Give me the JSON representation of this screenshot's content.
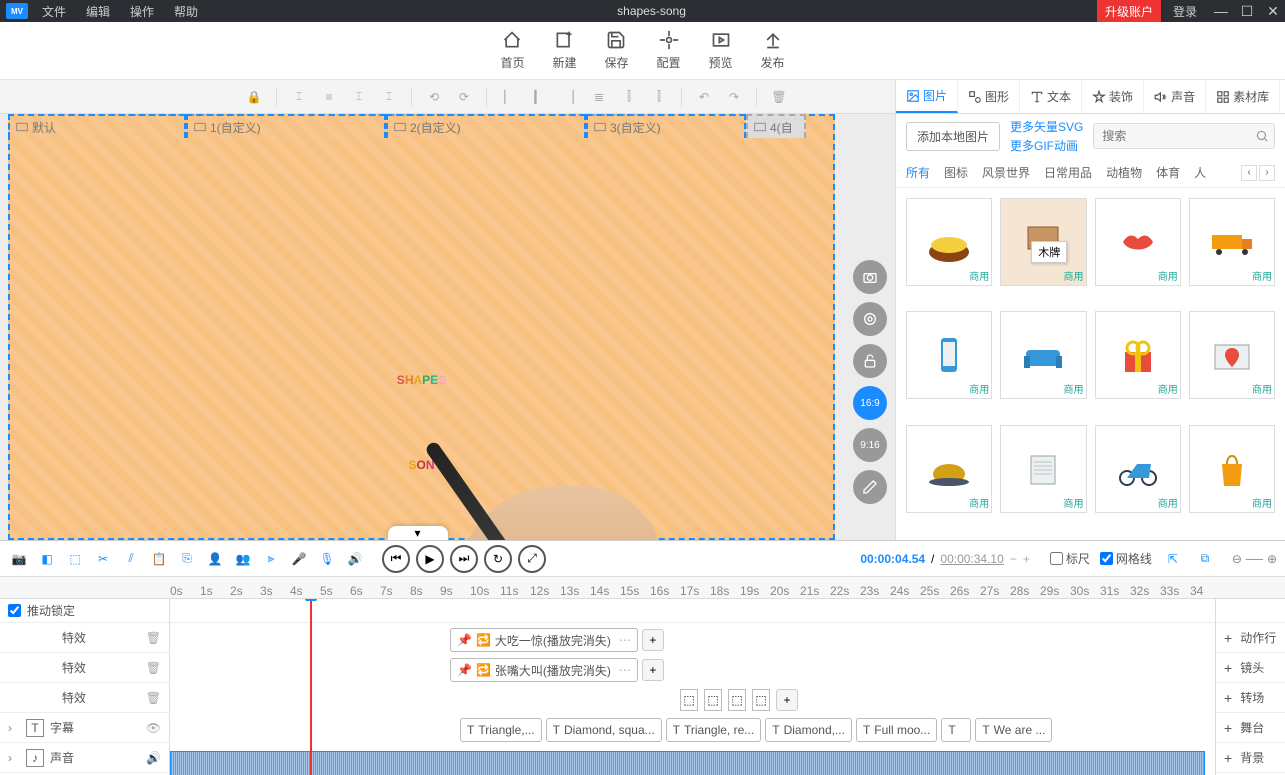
{
  "titlebar": {
    "logo": "MV",
    "menus": [
      "文件",
      "编辑",
      "操作",
      "帮助"
    ],
    "title": "shapes-song",
    "upgrade": "升级账户",
    "login": "登录"
  },
  "maintool": [
    {
      "k": "home",
      "label": "首页"
    },
    {
      "k": "new",
      "label": "新建"
    },
    {
      "k": "save",
      "label": "保存"
    },
    {
      "k": "config",
      "label": "配置"
    },
    {
      "k": "preview",
      "label": "预览"
    },
    {
      "k": "publish",
      "label": "发布"
    }
  ],
  "scenes": [
    "默认",
    "1(自定义)",
    "2(自定义)",
    "3(自定义)",
    "4(自"
  ],
  "canvas": {
    "text1": "SHAPES",
    "text2": "SON"
  },
  "ratios": [
    "16:9",
    "9:16"
  ],
  "rightPanel": {
    "tabs": [
      "图片",
      "图形",
      "文本",
      "装饰",
      "声音",
      "素材库"
    ],
    "addLocal": "添加本地图片",
    "links": [
      "更多矢量SVG",
      "更多GIF动画"
    ],
    "searchPlaceholder": "搜索",
    "cats": [
      "所有",
      "图标",
      "风景世界",
      "日常用品",
      "动植物",
      "体育",
      "人"
    ],
    "assetTag": "商用",
    "tooltip": "木牌"
  },
  "timeline": {
    "pushlock": "推动锁定",
    "current": "00:00:04.54",
    "total": "00:00:34.10",
    "ruler_opt": "标尺",
    "grid_opt": "网格线",
    "ticks": [
      "0s",
      "1s",
      "2s",
      "3s",
      "4s",
      "5s",
      "6s",
      "7s",
      "8s",
      "9s",
      "10s",
      "11s",
      "12s",
      "13s",
      "14s",
      "15s",
      "16s",
      "17s",
      "18s",
      "19s",
      "20s",
      "21s",
      "22s",
      "23s",
      "24s",
      "25s",
      "26s",
      "27s",
      "28s",
      "29s",
      "30s",
      "31s",
      "32s",
      "33s",
      "34"
    ],
    "rows": {
      "effects": "特效",
      "subtitle": "字幕",
      "audio": "声音"
    },
    "rightRows": [
      "动作行",
      "镜头",
      "转场",
      "舞台",
      "背景"
    ],
    "effect1": "大吃一惊(播放完消失)",
    "effect2": "张嘴大叫(播放完消失)",
    "subs": [
      "Triangle,...",
      "Diamond, squa...",
      "Triangle, re...",
      "Diamond,...",
      "Full moo...",
      "",
      "We are ..."
    ]
  }
}
